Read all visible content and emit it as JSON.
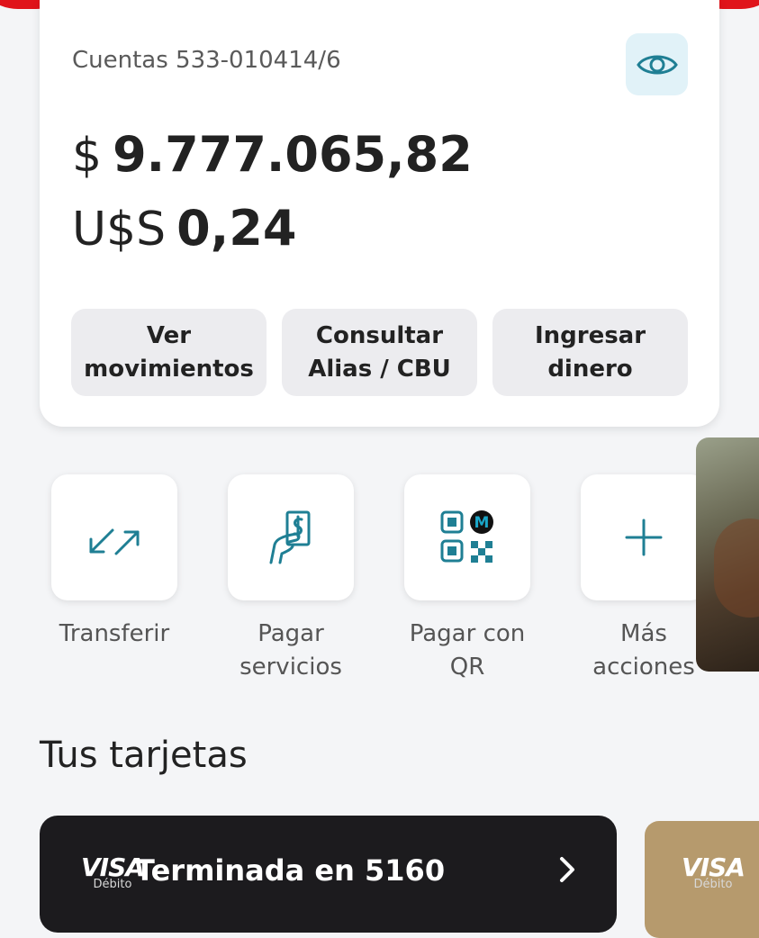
{
  "account": {
    "title": "Cuentas 533-010414/6",
    "balance_ars_currency": "$",
    "balance_ars_amount": "9.777.065,82",
    "balance_usd_currency": "U$S",
    "balance_usd_amount": "0,24",
    "actions": [
      {
        "label": "Ver\nmovimientos"
      },
      {
        "label": "Consultar\nAlias / CBU"
      },
      {
        "label": "Ingresar\ndinero"
      }
    ]
  },
  "quick_actions": [
    {
      "label": "Transferir",
      "icon": "transfer-arrows-icon"
    },
    {
      "label": "Pagar\nservicios",
      "icon": "pay-bill-hand-icon"
    },
    {
      "label": "Pagar con\nQR",
      "icon": "qr-code-icon"
    },
    {
      "label": "Más\nacciones",
      "icon": "plus-icon"
    }
  ],
  "cards_section": {
    "title": "Tus tarjetas",
    "cards": [
      {
        "brand": "VISA",
        "type": "Débito",
        "label": "Terminada en 5160"
      },
      {
        "brand": "VISA",
        "type": "Débito"
      }
    ]
  },
  "colors": {
    "brand_red": "#e0141b",
    "accent_teal": "#1f7f94",
    "eye_button_bg": "#e1f2f8",
    "dark_card": "#1c1b1e",
    "gold_card": "#b69a6d"
  }
}
